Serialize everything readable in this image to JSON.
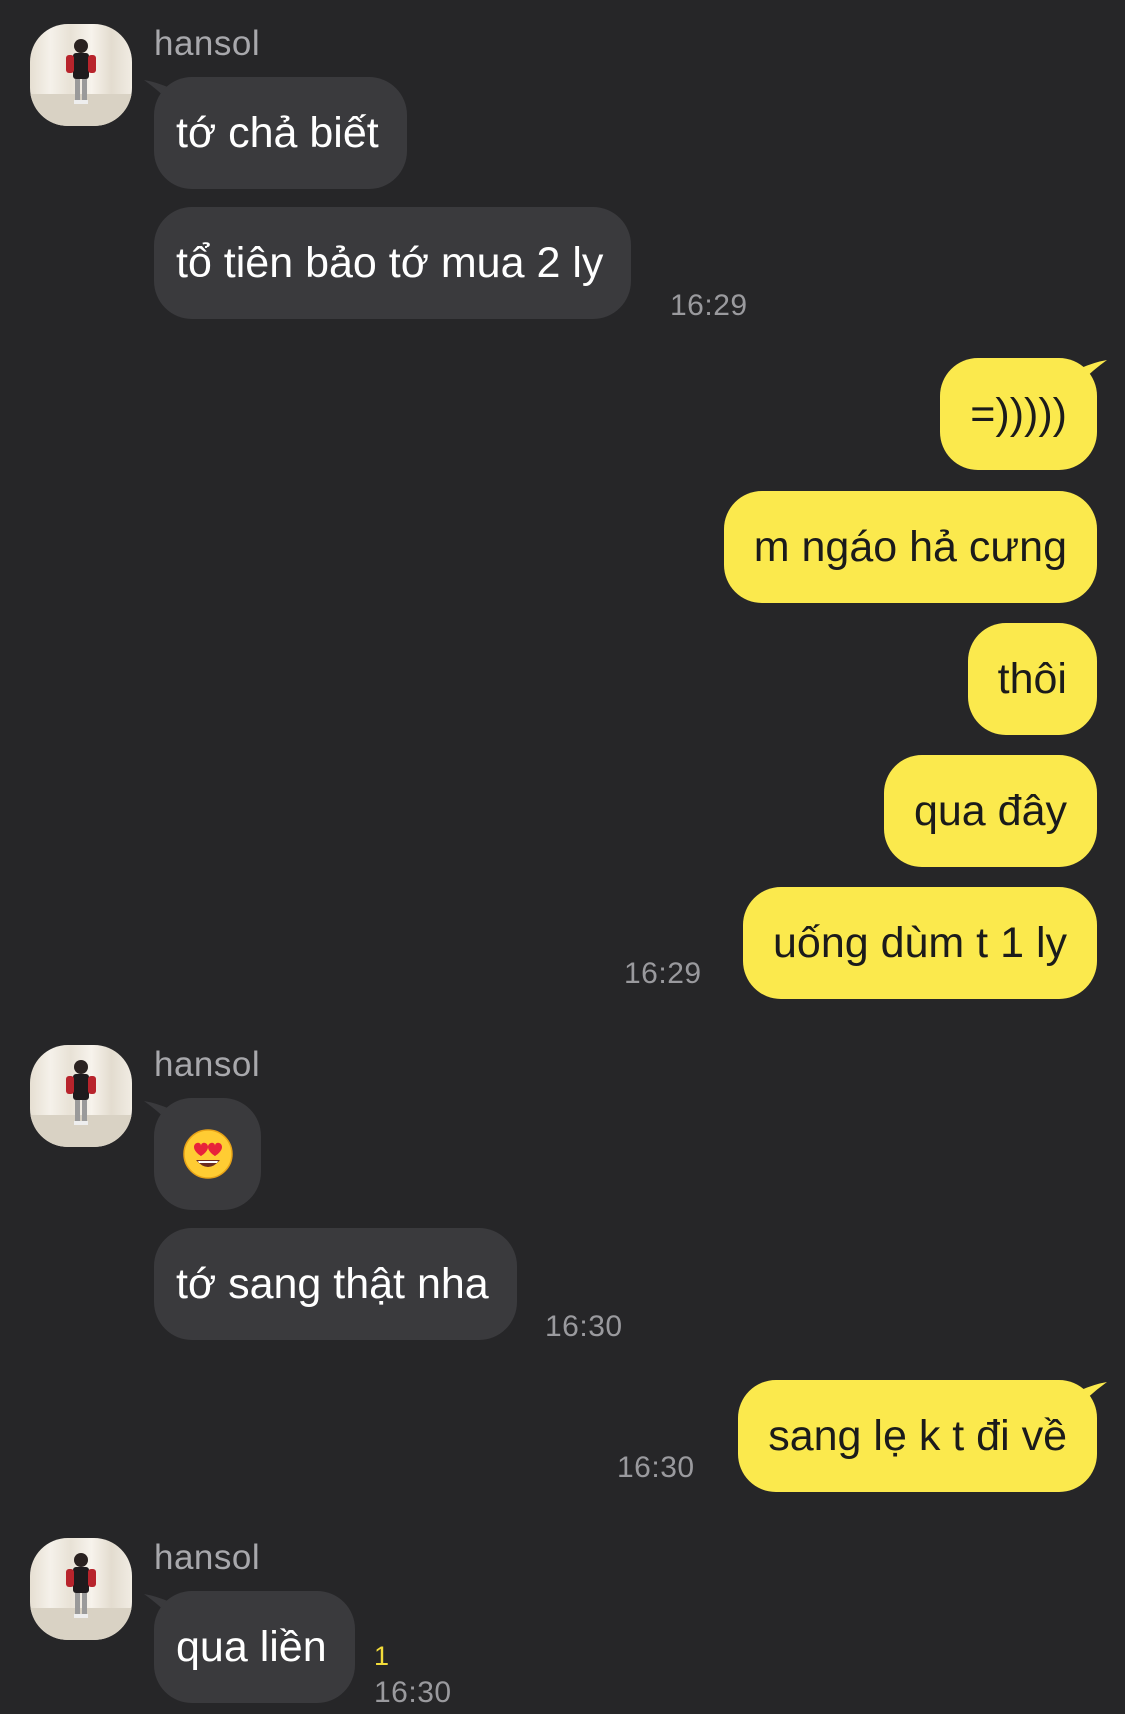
{
  "chat": {
    "sender_name": "hansol",
    "groups": [
      {
        "sender": "hansol",
        "messages": [
          "tớ chả biết",
          "tổ tiên bảo tớ mua 2 ly"
        ],
        "time": "16:29"
      },
      {
        "sender": "me",
        "messages": [
          "=)))))",
          "m ngáo hả cưng",
          "thôi",
          "qua đây",
          "uống dùm t 1 ly"
        ],
        "time": "16:29"
      },
      {
        "sender": "hansol",
        "messages": [
          "heart-eyes-emoji",
          "tớ sang thật nha"
        ],
        "time": "16:30"
      },
      {
        "sender": "me",
        "messages": [
          "sang lẹ k t đi về"
        ],
        "time": "16:30"
      },
      {
        "sender": "hansol",
        "messages": [
          "qua liền"
        ],
        "time": "16:30",
        "unread_count": "1"
      }
    ]
  },
  "icons": {
    "avatar": "profile-photo",
    "emoji": "smiling-face-with-heart-eyes"
  },
  "colors": {
    "background": "#262628",
    "incoming_bubble": "#3a3a3d",
    "outgoing_bubble": "#fbe94d",
    "unread_badge": "#f3dc3a"
  }
}
